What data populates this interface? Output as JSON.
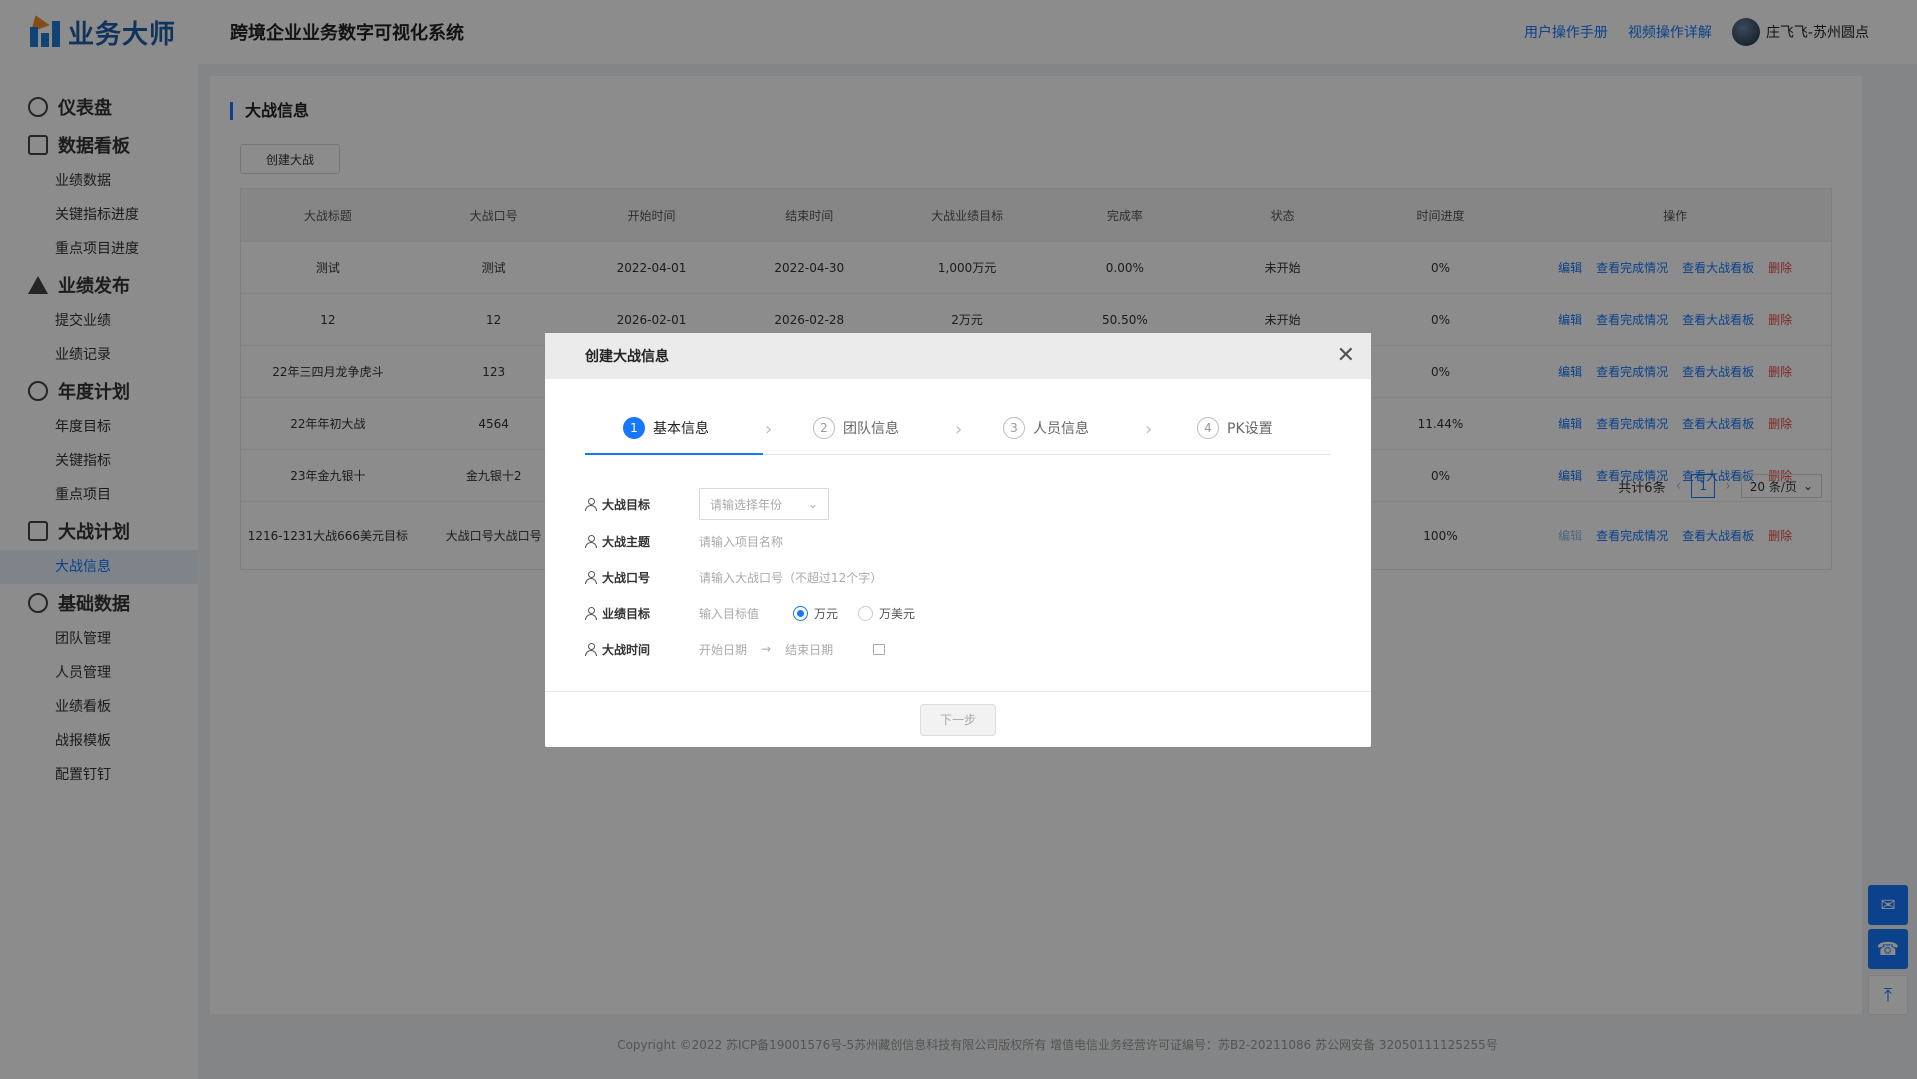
{
  "app": {
    "logo_text": "业务大师",
    "system_title": "跨境企业业务数字可视化系统"
  },
  "header": {
    "links": [
      "用户操作手册",
      "视频操作详解"
    ],
    "user_name": "庄飞飞-苏州圆点"
  },
  "sidebar": {
    "groups": [
      {
        "label": "仪表盘",
        "items": []
      },
      {
        "label": "数据看板",
        "items": [
          "业绩数据",
          "关键指标进度",
          "重点项目进度"
        ]
      },
      {
        "label": "业绩发布",
        "items": [
          "提交业绩",
          "业绩记录"
        ]
      },
      {
        "label": "年度计划",
        "items": [
          "年度目标",
          "关键指标",
          "重点项目"
        ]
      },
      {
        "label": "大战计划",
        "items": [
          "大战信息"
        ]
      },
      {
        "label": "基础数据",
        "items": [
          "团队管理",
          "人员管理",
          "业绩看板",
          "战报模板",
          "配置钉钉"
        ]
      }
    ],
    "active_item": "大战信息"
  },
  "page": {
    "section_title": "大战信息",
    "create_button": "创建大战"
  },
  "table": {
    "columns": [
      "大战标题",
      "大战口号",
      "开始时间",
      "结束时间",
      "大战业绩目标",
      "完成率",
      "状态",
      "时间进度",
      "操作"
    ],
    "ops": [
      "编辑",
      "查看完成情况",
      "查看大战看板",
      "删除"
    ],
    "rows": [
      [
        "测试",
        "测试",
        "2022-04-01",
        "2022-04-30",
        "1,000万元",
        "0.00%",
        "未开始",
        "0%"
      ],
      [
        "12",
        "12",
        "2026-02-01",
        "2026-02-28",
        "2万元",
        "50.50%",
        "未开始",
        "0%"
      ],
      [
        "22年三四月龙争虎斗",
        "123",
        "",
        "",
        "",
        "",
        "",
        "0%"
      ],
      [
        "22年年初大战",
        "4564",
        "",
        "",
        "",
        "",
        "",
        "11.44%"
      ],
      [
        "23年金九银十",
        "金九银十2",
        "",
        "",
        "",
        "",
        "",
        "0%"
      ],
      [
        "1216-1231大战666美元目标",
        "大战口号大战口号",
        "",
        "",
        "",
        "",
        "",
        "100%"
      ]
    ]
  },
  "pager": {
    "total": "共计6条",
    "current": "1",
    "page_size": "20 条/页"
  },
  "footer": {
    "text": "Copyright ©2022 苏ICP备19001576号-5苏州藏创信息科技有限公司版权所有    增值电信业务经营许可证编号：苏B2-20211086 苏公网安备 32050111125255号"
  },
  "modal": {
    "title": "创建大战信息",
    "steps": [
      {
        "num": "1",
        "label": "基本信息"
      },
      {
        "num": "2",
        "label": "团队信息"
      },
      {
        "num": "3",
        "label": "人员信息"
      },
      {
        "num": "4",
        "label": "PK设置"
      }
    ],
    "fields": {
      "target_label": "大战目标",
      "target_placeholder": "请输选择年份",
      "theme_label": "大战主题",
      "theme_placeholder": "请输入项目名称",
      "slogan_label": "大战口号",
      "slogan_placeholder": "请输入大战口号（不超过12个字）",
      "perf_label": "业绩目标",
      "perf_placeholder": "输入目标值",
      "unit_rmb": "万元",
      "unit_usd": "万美元",
      "time_label": "大战时间",
      "start_placeholder": "开始日期",
      "end_placeholder": "结束日期"
    },
    "next_button": "下一步"
  }
}
